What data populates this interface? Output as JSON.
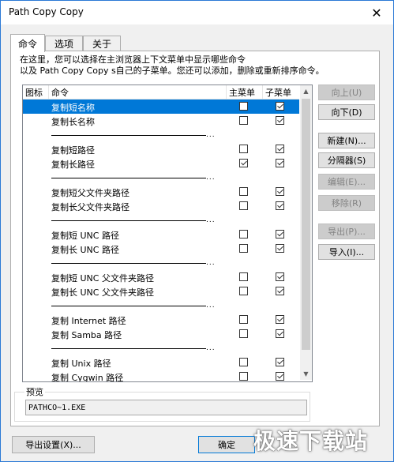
{
  "window": {
    "title": "Path Copy Copy",
    "close_glyph": "✕"
  },
  "tabs": [
    {
      "label": "命令",
      "active": true
    },
    {
      "label": "选项",
      "active": false
    },
    {
      "label": "关于",
      "active": false
    }
  ],
  "description": [
    "在这里，您可以选择在主浏览器上下文菜单中显示哪些命令",
    "以及 Path Copy Copy s自己的子菜单。您还可以添加，删除或重新排序命令。"
  ],
  "list": {
    "headers": {
      "icon": "图标",
      "command": "命令",
      "main_menu": "主菜单",
      "sub_menu": "子菜单"
    },
    "separator_dots": "...",
    "rows": [
      {
        "type": "item",
        "label": "复制短名称",
        "main": false,
        "sub": true,
        "selected": true
      },
      {
        "type": "item",
        "label": "复制长名称",
        "main": false,
        "sub": true
      },
      {
        "type": "separator"
      },
      {
        "type": "item",
        "label": "复制短路径",
        "main": false,
        "sub": true
      },
      {
        "type": "item",
        "label": "复制长路径",
        "main": true,
        "sub": true
      },
      {
        "type": "separator"
      },
      {
        "type": "item",
        "label": "复制短父文件夹路径",
        "main": false,
        "sub": true
      },
      {
        "type": "item",
        "label": "复制长父文件夹路径",
        "main": false,
        "sub": true
      },
      {
        "type": "separator"
      },
      {
        "type": "item",
        "label": "复制短 UNC 路径",
        "main": false,
        "sub": true
      },
      {
        "type": "item",
        "label": "复制长 UNC 路径",
        "main": false,
        "sub": true
      },
      {
        "type": "separator"
      },
      {
        "type": "item",
        "label": "复制短 UNC 父文件夹路径",
        "main": false,
        "sub": true
      },
      {
        "type": "item",
        "label": "复制长 UNC 父文件夹路径",
        "main": false,
        "sub": true
      },
      {
        "type": "separator"
      },
      {
        "type": "item",
        "label": "复制 Internet 路径",
        "main": false,
        "sub": true
      },
      {
        "type": "item",
        "label": "复制 Samba 路径",
        "main": false,
        "sub": true
      },
      {
        "type": "separator"
      },
      {
        "type": "item",
        "label": "复制 Unix 路径",
        "main": false,
        "sub": true
      },
      {
        "type": "item",
        "label": "复制 Cygwin 路径",
        "main": false,
        "sub": true
      }
    ]
  },
  "side_buttons": [
    {
      "label": "向上(U)",
      "enabled": false
    },
    {
      "label": "向下(D)",
      "enabled": true
    },
    {
      "label": "新建(N)...",
      "enabled": true
    },
    {
      "label": "分隔器(S)",
      "enabled": true
    },
    {
      "label": "编辑(E)...",
      "enabled": false
    },
    {
      "label": "移除(R)",
      "enabled": false
    },
    {
      "label": "导出(P)...",
      "enabled": false
    },
    {
      "label": "导入(I)...",
      "enabled": true
    }
  ],
  "preview": {
    "label": "预览",
    "value": "PATHCO~1.EXE"
  },
  "bottom": {
    "export_settings": "导出设置(X)...",
    "ok": "确定"
  },
  "watermark": "极速下载站"
}
